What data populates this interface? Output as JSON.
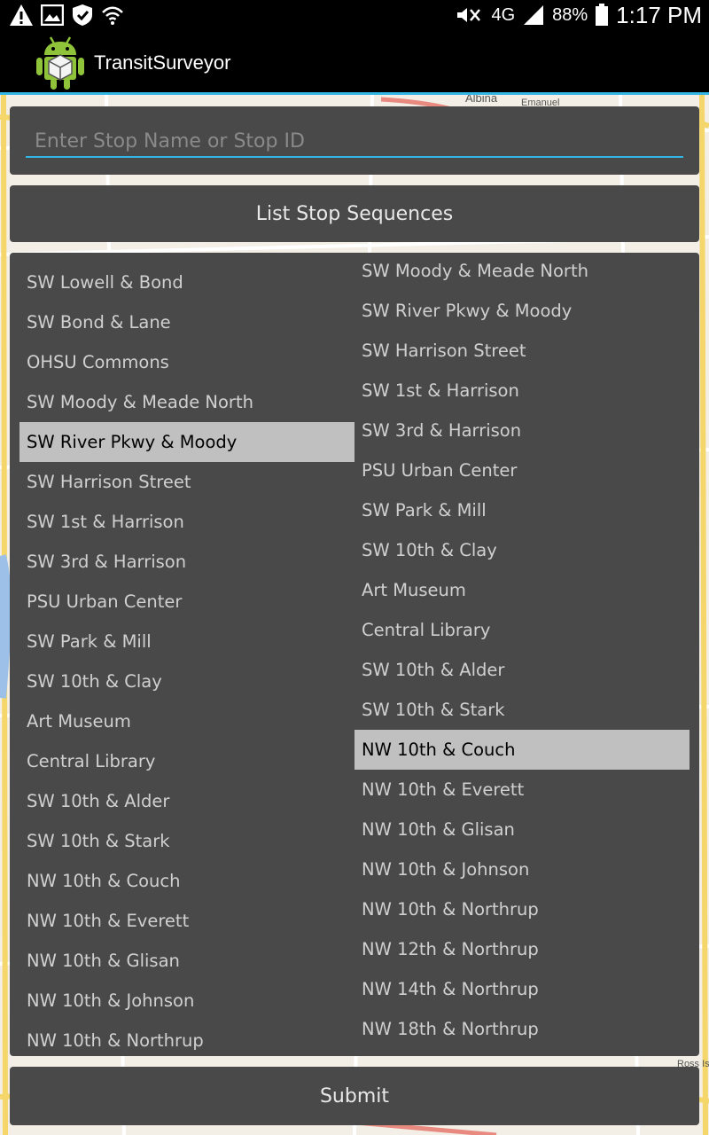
{
  "status_bar": {
    "left_icons": [
      "warning-icon",
      "image-icon",
      "shield-icon",
      "wifi-icon"
    ],
    "network": "4G",
    "battery": "88%",
    "time": "1:17 PM"
  },
  "app": {
    "title": "TransitSurveyor"
  },
  "search": {
    "placeholder": "Enter Stop Name or Stop ID",
    "value": ""
  },
  "list_button": {
    "label": "List Stop Sequences"
  },
  "left_list": {
    "selected_index": 4,
    "items": [
      "SW Lowell & Bond",
      "SW Bond & Lane",
      "OHSU Commons",
      "SW Moody & Meade North",
      "SW River Pkwy & Moody",
      "SW Harrison Street",
      "SW 1st & Harrison",
      "SW 3rd & Harrison",
      "PSU Urban Center",
      "SW Park & Mill",
      "SW 10th & Clay",
      "Art Museum",
      "Central Library",
      "SW 10th & Alder",
      "SW 10th & Stark",
      "NW 10th & Couch",
      "NW 10th & Everett",
      "NW 10th & Glisan",
      "NW 10th & Johnson",
      "NW 10th & Northrup"
    ]
  },
  "right_list": {
    "selected_index": 12,
    "items": [
      "SW Moody & Meade North",
      "SW River Pkwy & Moody",
      "SW Harrison Street",
      "SW 1st & Harrison",
      "SW 3rd & Harrison",
      "PSU Urban Center",
      "SW Park & Mill",
      "SW 10th & Clay",
      "Art Museum",
      "Central Library",
      "SW 10th & Alder",
      "SW 10th & Stark",
      "NW 10th & Couch",
      "NW 10th & Everett",
      "NW 10th & Glisan",
      "NW 10th & Johnson",
      "NW 10th & Northrup",
      "NW 12th & Northrup",
      "NW 14th & Northrup",
      "NW 18th & Northrup"
    ]
  },
  "map_labels": {
    "top": "Albina",
    "top2": "Emanuel",
    "bottom_right": "Ross Is"
  },
  "submit_button": {
    "label": "Submit"
  },
  "colors": {
    "accent": "#33b5e5",
    "panel": "#494949",
    "selected": "#c0c0c0",
    "map_bg": "#f3efe6"
  }
}
